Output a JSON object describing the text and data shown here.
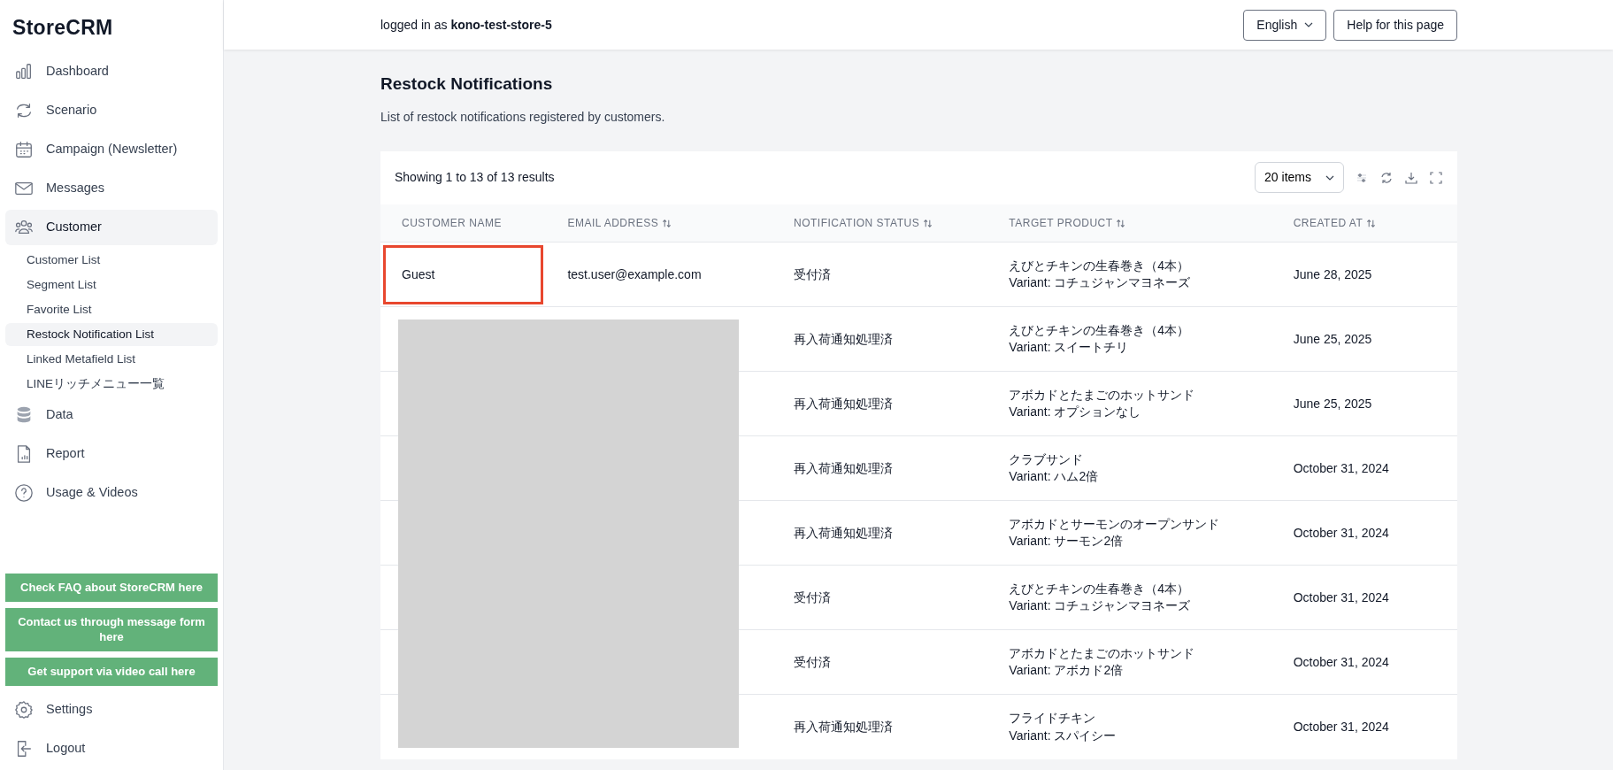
{
  "brand": "StoreCRM",
  "sidebar": {
    "items": [
      {
        "label": "Dashboard",
        "selected": false
      },
      {
        "label": "Scenario",
        "selected": false
      },
      {
        "label": "Campaign (Newsletter)",
        "selected": false
      },
      {
        "label": "Messages",
        "selected": false
      },
      {
        "label": "Customer",
        "selected": true,
        "children": [
          {
            "label": "Customer List",
            "selected": false
          },
          {
            "label": "Segment List",
            "selected": false
          },
          {
            "label": "Favorite List",
            "selected": false
          },
          {
            "label": "Restock Notification List",
            "selected": true
          },
          {
            "label": "Linked Metafield List",
            "selected": false
          },
          {
            "label": "LINEリッチメニュー一覧",
            "selected": false
          }
        ]
      },
      {
        "label": "Data",
        "selected": false
      },
      {
        "label": "Report",
        "selected": false
      },
      {
        "label": "Usage & Videos",
        "selected": false
      }
    ],
    "support_buttons": [
      "Check FAQ about StoreCRM here",
      "Contact us through message form here",
      "Get support via video call here"
    ],
    "bottom_items": [
      {
        "label": "Settings"
      },
      {
        "label": "Logout"
      }
    ]
  },
  "header": {
    "logged_in_prefix": "logged in as",
    "store": "kono-test-store-5",
    "language": "English",
    "help": "Help for this page"
  },
  "page": {
    "title": "Restock Notifications",
    "subtitle": "List of restock notifications registered by customers."
  },
  "table": {
    "summary": "Showing 1 to 13 of 13 results",
    "page_size": "20 items",
    "columns": [
      {
        "label": "CUSTOMER NAME",
        "sortable": false
      },
      {
        "label": "EMAIL ADDRESS",
        "sortable": true
      },
      {
        "label": "NOTIFICATION STATUS",
        "sortable": true
      },
      {
        "label": "TARGET PRODUCT",
        "sortable": true
      },
      {
        "label": "CREATED AT",
        "sortable": true
      }
    ],
    "rows": [
      {
        "customer": "Guest",
        "email": "test.user@example.com",
        "status": "受付済",
        "product": "えびとチキンの生春巻き（4本）",
        "variant": "Variant: コチュジャンマヨネーズ",
        "created": "June 28, 2025",
        "highlighted": true
      },
      {
        "status": "再入荷通知処理済",
        "product": "えびとチキンの生春巻き（4本）",
        "variant": "Variant: スイートチリ",
        "created": "June 25, 2025",
        "highlighted": false
      },
      {
        "status": "再入荷通知処理済",
        "product": "アボカドとたまごのホットサンド",
        "variant": "Variant: オプションなし",
        "created": "June 25, 2025",
        "highlighted": false
      },
      {
        "status": "再入荷通知処理済",
        "product": "クラブサンド",
        "variant": "Variant: ハム2倍",
        "created": "October 31, 2024",
        "highlighted": false
      },
      {
        "status": "再入荷通知処理済",
        "product": "アボカドとサーモンのオープンサンド",
        "variant": "Variant: サーモン2倍",
        "created": "October 31, 2024",
        "highlighted": false
      },
      {
        "status": "受付済",
        "product": "えびとチキンの生春巻き（4本）",
        "variant": "Variant: コチュジャンマヨネーズ",
        "created": "October 31, 2024",
        "highlighted": false
      },
      {
        "status": "受付済",
        "product": "アボカドとたまごのホットサンド",
        "variant": "Variant: アボカド2倍",
        "created": "October 31, 2024",
        "highlighted": false
      },
      {
        "status": "再入荷通知処理済",
        "product": "フライドチキン",
        "variant": "Variant: スパイシー",
        "created": "October 31, 2024",
        "highlighted": false
      }
    ]
  }
}
